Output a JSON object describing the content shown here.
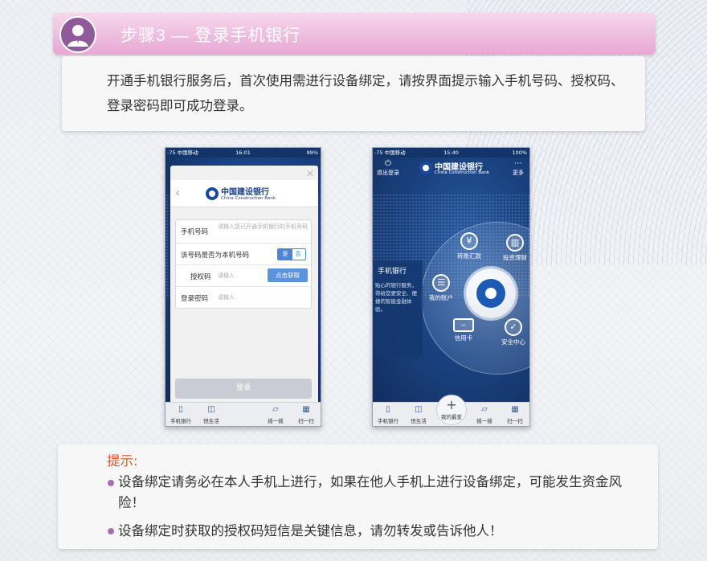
{
  "header": {
    "title": "步骤3 — 登录手机银行",
    "avatar_icon": "user-avatar-icon",
    "color": "#e6a8d3"
  },
  "intro": {
    "text": "开通手机银行服务后，首次使用需进行设备绑定，请按界面提示输入手机号码、授权码、登录密码即可成功登录。"
  },
  "left_phone": {
    "status": {
      "carrier": "-75 中国移动",
      "time": "16:01",
      "battery": "99%"
    },
    "bank_name_cn": "中国建设银行",
    "bank_name_en": "China Construction Bank",
    "form": {
      "phone_label": "手机号码",
      "phone_placeholder": "请输入您已开通手机银行的手机号码",
      "own_label": "该号码是否为本机号码",
      "yes": "是",
      "no": "否",
      "auth_label": "授权码",
      "auth_placeholder": "请输入",
      "get_code": "点击获取",
      "password_label": "登录密码",
      "password_placeholder": "请输入"
    },
    "login_button": "登录",
    "tabs": [
      "手机银行",
      "悦生活",
      "摇一摇",
      "扫一扫"
    ]
  },
  "right_phone": {
    "status": {
      "carrier": "-75 中国移动",
      "time": "15:40",
      "battery": "100%"
    },
    "bank_name_cn": "中国建设银行",
    "bank_name_en": "China Construction Bank",
    "logout": "退出登录",
    "more": "更多",
    "side_title": "手机银行",
    "side_desc": "贴心的银行服务，带给您更安全、便捷的智能金融体验。",
    "wheel_items": {
      "transfer": "转账汇款",
      "invest": "投资理财",
      "account": "我的账户",
      "credit": "信用卡",
      "security": "安全中心"
    },
    "tabs": [
      "手机银行",
      "悦生活",
      "我的最爱",
      "摇一摇",
      "扫一扫"
    ]
  },
  "tips": {
    "title": "提示:",
    "items": [
      "设备绑定请务必在本人手机上进行，如果在他人手机上进行设备绑定，可能发生资金风险！",
      "设备绑定时获取的授权码短信是关键信息，请勿转发或告诉他人！"
    ],
    "title_color": "#e0572a",
    "bullet_color": "#a770b6"
  }
}
